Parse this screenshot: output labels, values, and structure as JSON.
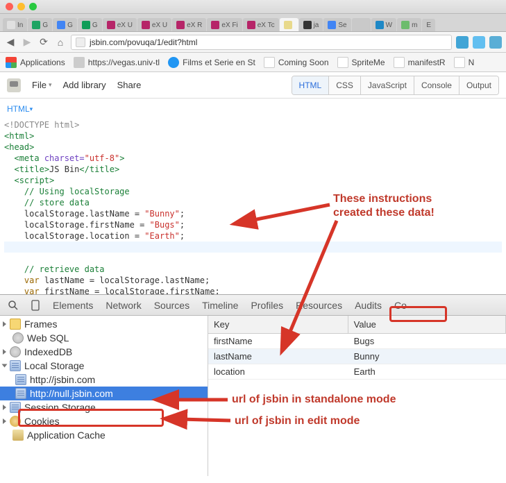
{
  "browser_tabs": [
    {
      "label": "In"
    },
    {
      "label": "G"
    },
    {
      "label": "G"
    },
    {
      "label": "G"
    },
    {
      "label": "eX U"
    },
    {
      "label": "eX U"
    },
    {
      "label": "eX R"
    },
    {
      "label": "eX Fi"
    },
    {
      "label": "eX Tc"
    },
    {
      "label": ""
    },
    {
      "label": "ja"
    },
    {
      "label": "Se"
    },
    {
      "label": ""
    },
    {
      "label": "W"
    },
    {
      "label": "m"
    },
    {
      "label": "E"
    }
  ],
  "url": "jsbin.com/povuqa/1/edit?html",
  "bookmarks": [
    {
      "label": "Applications"
    },
    {
      "label": "https://vegas.univ-tl"
    },
    {
      "label": "Films et Serie en St"
    },
    {
      "label": "Coming Soon"
    },
    {
      "label": "SpriteMe"
    },
    {
      "label": "manifestR"
    },
    {
      "label": "N"
    }
  ],
  "jsbin_menu": {
    "file": "File",
    "add_library": "Add library",
    "share": "Share"
  },
  "panel_tabs": {
    "html": "HTML",
    "css": "CSS",
    "js": "JavaScript",
    "console": "Console",
    "output": "Output"
  },
  "panel_header": "HTML",
  "code": {
    "l1": "<!DOCTYPE html>",
    "l2": "<html>",
    "l3": "<head>",
    "l4_tag": "meta",
    "l4_attr": "charset=",
    "l4_val": "\"utf-8\"",
    "l5_tag_open": "title",
    "l5_text": "JS Bin",
    "l5_tag_close": "title",
    "l6": "script",
    "c1": "// Using localStorage",
    "c2": "// store data",
    "s1": "localStorage.lastName = ",
    "s1v": "\"Bunny\"",
    "s1e": ";",
    "s2": "localStorage.firstName = ",
    "s2v": "\"Bugs\"",
    "s2e": ";",
    "s3": "localStorage.location = ",
    "s3v": "\"Earth\"",
    "s3e": ";",
    "c3": "// retrieve data",
    "r1a": "var",
    "r1b": " lastName = localStorage.lastName;",
    "r2a": "var",
    "r2b": " firstName = localStorage.firstName;"
  },
  "devtools_tabs": {
    "elements": "Elements",
    "network": "Network",
    "sources": "Sources",
    "timeline": "Timeline",
    "profiles": "Profiles",
    "resources": "Resources",
    "audits": "Audits",
    "console": "Co"
  },
  "tree": {
    "frames": "Frames",
    "websql": "Web SQL",
    "idb": "IndexedDB",
    "ls": "Local Storage",
    "ls1": "http://jsbin.com",
    "ls2": "http://null.jsbin.com",
    "ss": "Session Storage",
    "cookies": "Cookies",
    "appcache": "Application Cache"
  },
  "table": {
    "hk": "Key",
    "hv": "Value",
    "rows": [
      {
        "k": "firstName",
        "v": "Bugs"
      },
      {
        "k": "lastName",
        "v": "Bunny"
      },
      {
        "k": "location",
        "v": "Earth"
      }
    ]
  },
  "annotations": {
    "a1": "These instructions",
    "a2": "created these data!",
    "a3": "url of jsbin in standalone mode",
    "a4": "url of jsbin in edit mode"
  }
}
